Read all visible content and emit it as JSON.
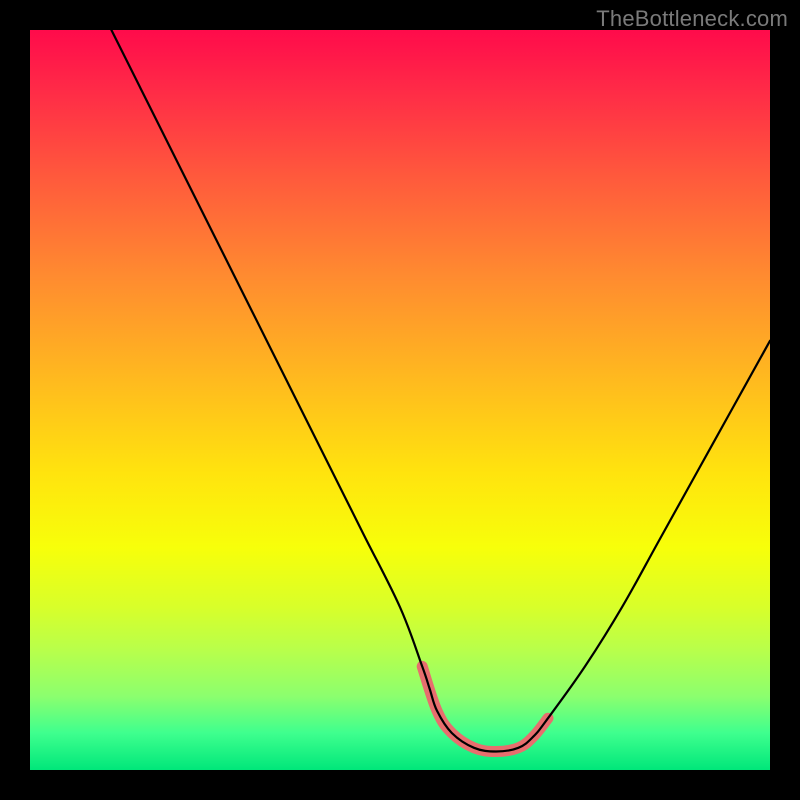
{
  "watermark": "TheBottleneck.com",
  "chart_data": {
    "type": "line",
    "title": "",
    "xlabel": "",
    "ylabel": "",
    "xlim": [
      0,
      100
    ],
    "ylim": [
      0,
      100
    ],
    "series": [
      {
        "name": "bottleneck-curve",
        "color": "#000000",
        "width": 2.2,
        "x": [
          11,
          15,
          20,
          25,
          30,
          35,
          40,
          45,
          50,
          53,
          54,
          55,
          57,
          60,
          63,
          66,
          68,
          70,
          75,
          80,
          85,
          90,
          95,
          100
        ],
        "y": [
          100,
          92,
          82,
          72,
          62,
          52,
          42,
          32,
          22,
          14,
          11,
          8,
          5,
          3,
          2.5,
          3,
          4.5,
          7,
          14,
          22,
          31,
          40,
          49,
          58
        ]
      },
      {
        "name": "optimal-highlight",
        "color": "#e76e6e",
        "width": 11,
        "cap": "round",
        "x": [
          53,
          55,
          57,
          60,
          63,
          66,
          68,
          70
        ],
        "y": [
          14,
          8,
          5,
          3,
          2.5,
          3,
          4.5,
          7
        ]
      }
    ]
  }
}
